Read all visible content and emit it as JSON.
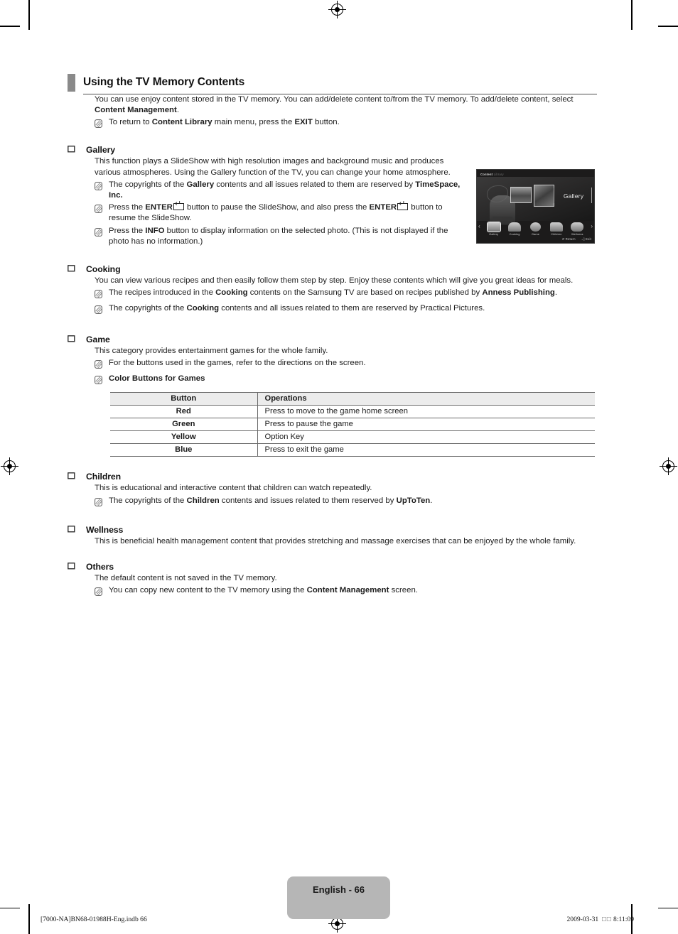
{
  "document": {
    "section_title": "Using the TV Memory Contents",
    "intro": {
      "text_before": "You can use enjoy content stored in the TV memory. You can add/delete content to/from the TV memory. To add/delete content, select ",
      "bold": "Content Management",
      "text_after": "."
    },
    "intro_note": {
      "a": "To return to ",
      "b1": "Content Library",
      "c": " main menu, press the ",
      "b2": "EXIT",
      "d": " button."
    }
  },
  "gallery": {
    "heading": "Gallery",
    "body": "This function plays a SlideShow with high resolution images and background music and produces various atmospheres. Using the Gallery function of the TV, you can change your home atmosphere.",
    "note1": {
      "a": "The copyrights of the ",
      "b1": "Gallery",
      "c": " contents and all issues related to them are reserved by ",
      "b2": "TimeSpace, Inc."
    },
    "note2": {
      "a": "Press the ",
      "b1": "ENTER",
      "c": " button to pause the SlideShow, and also press the ",
      "b2": "ENTER",
      "d": " button to resume the SlideShow."
    },
    "note3": {
      "a": "Press the ",
      "b1": "INFO",
      "c": " button to display information on the selected photo. (This is not displayed if the photo has no information.)"
    }
  },
  "tv_screenshot": {
    "header_bold": "Content",
    "header_light": " Library",
    "selected_label": "Gallery",
    "menu": [
      {
        "label": "Gallery",
        "icon": "gallery-icon",
        "selected": true
      },
      {
        "label": "Cooking",
        "icon": "cooking-icon",
        "selected": false
      },
      {
        "label": "Game",
        "icon": "game-icon",
        "selected": false
      },
      {
        "label": "Children",
        "icon": "children-icon",
        "selected": false
      },
      {
        "label": "Wellness",
        "icon": "wellness-icon",
        "selected": false
      }
    ],
    "arrow_left": "‹",
    "arrow_right": "›",
    "footer_return": "↺ Return",
    "footer_exit": "→] Exit"
  },
  "cooking": {
    "heading": "Cooking",
    "body": "You can view various recipes and then easily follow them step by step. Enjoy these contents which will give you great ideas for meals.",
    "note1": {
      "a": "The recipes introduced in the ",
      "b1": "Cooking",
      "c": " contents on the Samsung TV are based on recipes published by ",
      "b2": "Anness Publishing",
      "d": "."
    },
    "note2": {
      "a": "The copyrights of the ",
      "b1": "Cooking",
      "c": " contents and all issues related to them are reserved by Practical Pictures."
    }
  },
  "game": {
    "heading": "Game",
    "body": "This category provides entertainment games for the whole family.",
    "note1": "For the buttons used in the games, refer to the directions on the screen.",
    "note2_bold": "Color Buttons for Games",
    "table": {
      "headers": [
        "Button",
        "Operations"
      ],
      "rows": [
        [
          "Red",
          "Press to move to the game home screen"
        ],
        [
          "Green",
          "Press to pause the game"
        ],
        [
          "Yellow",
          "Option Key"
        ],
        [
          "Blue",
          "Press to exit the game"
        ]
      ]
    }
  },
  "children": {
    "heading": "Children",
    "body": "This is educational and interactive content that children can watch repeatedly.",
    "note1": {
      "a": "The copyrights of the ",
      "b1": "Children",
      "c": " contents and issues related to them reserved by ",
      "b2": "UpToTen",
      "d": "."
    }
  },
  "wellness": {
    "heading": "Wellness",
    "body": "This is beneficial health management content that provides stretching and massage exercises that can be enjoyed by the whole family."
  },
  "others": {
    "heading": "Others",
    "body": "The default content is not saved in the TV memory.",
    "note1": {
      "a": "You can copy new content to the TV memory using the ",
      "b1": "Content Management",
      "c": " screen."
    }
  },
  "footer": {
    "page_badge": "English - 66",
    "left": "[7000-NA]BN68-01988H-Eng.indb   66",
    "right_date": "2009-03-31",
    "right_unknown": "□□",
    "right_time": "8:11:09"
  },
  "colors": {
    "title_mark": "#8a8a8a",
    "rule": "#4d4d4d",
    "table_header_bg": "#ececec",
    "page_badge_bg": "#b6b6b6",
    "tv_bg": "#1c1b1b"
  }
}
